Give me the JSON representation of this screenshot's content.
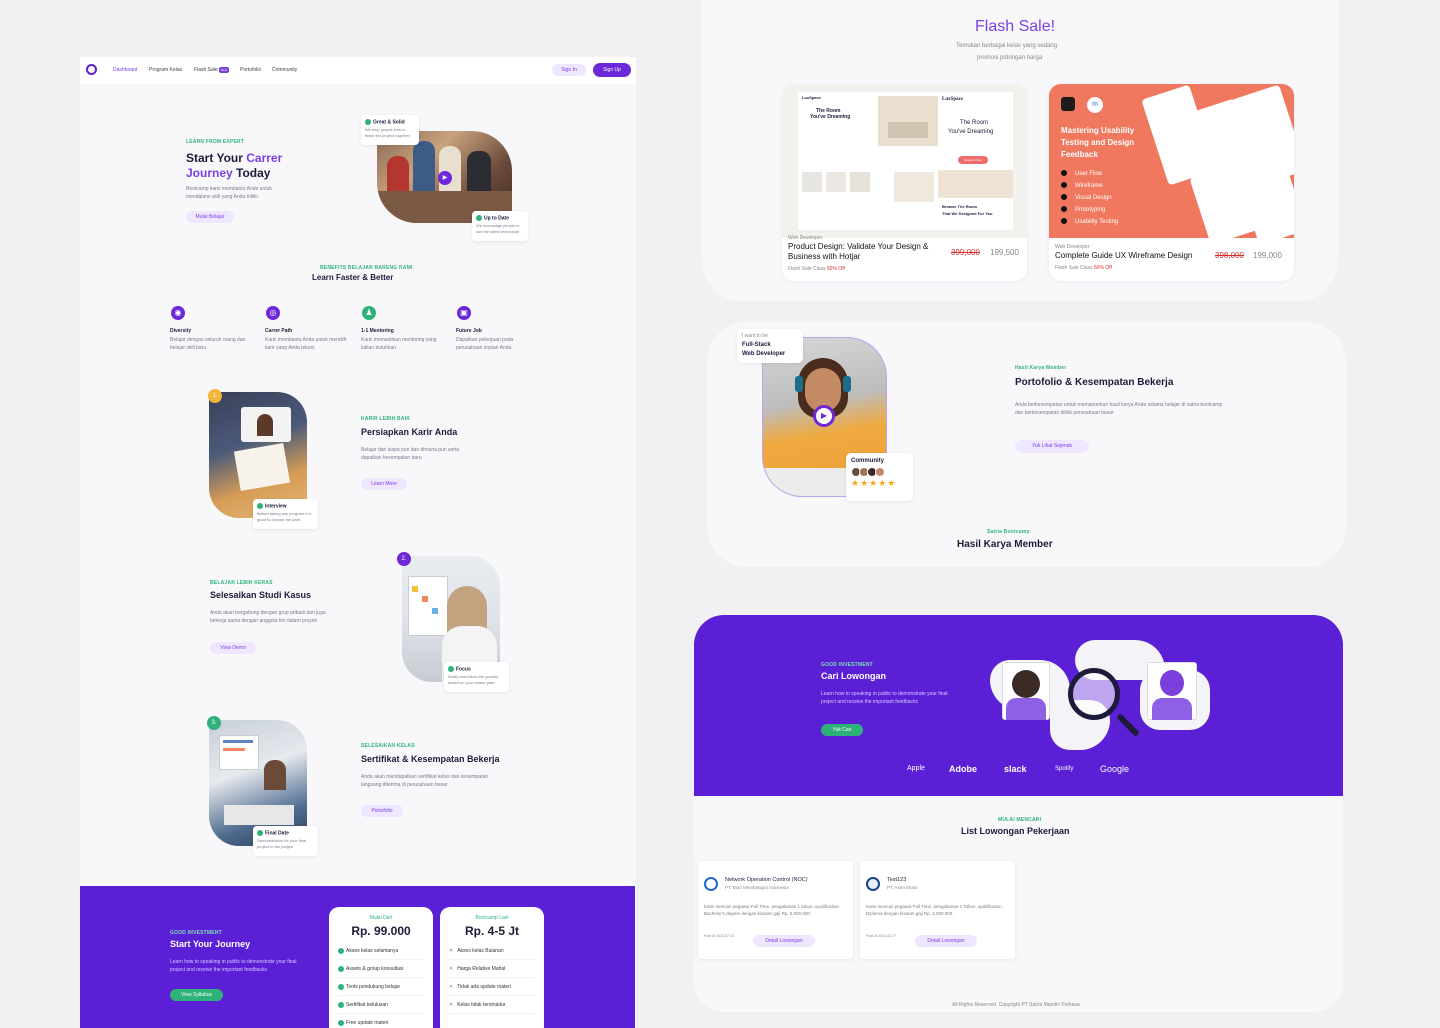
{
  "nav": {
    "items": [
      "Dashboard",
      "Program Kelas",
      "Flash Sale",
      "Portofolio",
      "Community"
    ],
    "flash_badge": "New",
    "signin": "Sign In",
    "signup": "Sign Up"
  },
  "hero": {
    "label": "LEARN FROM EXPERT",
    "title_line1_a": "Start Your ",
    "title_line1_b": "Carrer",
    "title_line2_a": "Journey",
    "title_line2_b": " Today",
    "desc": "Bootcamp kami membantu Anda untuk mendalami skill yang Anda miliki",
    "cta": "Mulai Belajar",
    "badge1_title": "Great & Solid",
    "badge1_desc": "We help people how to finish the project together",
    "badge2_title": "Up to Date",
    "badge2_desc": "We encourage people to use the latest technolodi"
  },
  "benefits": {
    "label": "BENEFITS BELAJAR BARENG KAMI",
    "title": "Learn Faster & Better",
    "items": [
      {
        "title": "Diversity",
        "desc": "Belajar dengan seluruh orang dan belajar skill baru"
      },
      {
        "title": "Carrer Path",
        "desc": "Kami membantu Anda untuk memilih karir yang Anda tekuni"
      },
      {
        "title": "1-1 Mentoring",
        "desc": "Kami memastikan mentoring yang kalian butuhkan"
      },
      {
        "title": "Future Job",
        "desc": "Dapatkan pekerjaan pada perusahaan impian Anda"
      }
    ]
  },
  "steps": [
    {
      "num": "1.",
      "label": "KARIR LEBIH BAIK",
      "title": "Persiapkan Karir Anda",
      "desc": "Belajar dari siapa pun dan dimana pun serta dapatkan kesempatan baru",
      "cta": "Learn More",
      "badge_title": "Interview",
      "badge_desc": "Before taking any program it is good to choose the path"
    },
    {
      "num": "2.",
      "label": "BELAJAR LEBIH KERAS",
      "title": "Selesaikan Studi Kasus",
      "desc": "Anda akan bergabung dengan grup pribadi dan juga bekerja sama dengan anggota tim dalam proyek",
      "cta": "View Demo",
      "badge_title": "Focus",
      "badge_desc": "Study and follow the journey based on your career path"
    },
    {
      "num": "3.",
      "label": "SELESAIKAN KELAS",
      "title": "Sertifikat & Kesempatan Bekerja",
      "desc": "Anda akan mendapatkan sertifikat kelas dan kesempatan langsung diterima di perusahaan besar",
      "cta": "Portofolio",
      "badge_title": "Final Date",
      "badge_desc": "Demonstration for your final project to the judges"
    }
  ],
  "journey": {
    "label": "GOOD INVESTMENT",
    "title": "Start Your Journey",
    "desc": "Learn how to speaking in public to demonstrate your final project and receive the important feedbacks",
    "cta": "View Syllabus",
    "plan1": {
      "label": "Mulai Dari",
      "price": "Rp. 99.000",
      "items": [
        "Akses kelas selamanya",
        "Assets & group konsultasi",
        "Tools pendukung belajar",
        "Sertifikat kelulusan",
        "Free update materi"
      ]
    },
    "plan2": {
      "label": "Bootcamp Lain",
      "price": "Rp. 4-5 Jt",
      "items": [
        "Akses kelas Bulanan",
        "Harga Relative Mahal",
        "Tidak ada update materi",
        "Kelas tidak terstruktur"
      ]
    }
  },
  "flash": {
    "title": "Flash Sale!",
    "desc1": "Temukan berbagai kelas yang sedang",
    "desc2": "promosi potongan harga",
    "card1": {
      "category": "Web Developer",
      "title1": "Product Design: Validate Your Design &",
      "title2": "Business with Hotjar",
      "old_price": "399,000",
      "price": "199,500",
      "sub": "Flash Sale Class ",
      "discount": "50% Off",
      "brand": "LuxSpace",
      "hero_text1": "The Room",
      "hero_text2": "You've Dreaming",
      "explore": "Explore Now",
      "bottom1": "Browse The Room",
      "bottom2": "That We Designed For You"
    },
    "card2": {
      "category": "Web Developer",
      "title": "Complete Guide UX Wireframe Design",
      "old_price": "398,000",
      "price": "199,000",
      "sub": "Flash Sale Class ",
      "discount": "50% Off",
      "heading1": "Mastering Usability",
      "heading2": "Testing and Design",
      "heading3": "Feedback",
      "list": [
        "User Flow",
        "Wireframe",
        "Visual Design",
        "Prototyping",
        "Usability Testing"
      ]
    }
  },
  "portfolio": {
    "badge_small": "I want to be",
    "badge_line1": "Full-Stack",
    "badge_line2": "Web Developer",
    "community": "Community",
    "stars": "★★★★★",
    "label": "Hasil Karya Member",
    "title": "Portofolio & Kesempatan Bekerja",
    "desc": "Anda berkesempatan untuk memamerkan hasil karya Anda selama belajar di satria bootcamp dan berkesempatan dilirik perusahaan besar",
    "cta": "Yuk Lihat Sejenak",
    "footer_label": "Satria Bootcamp",
    "footer_title": "Hasil Karya Member"
  },
  "jobs": {
    "label": "GOOD INVESTMENT",
    "title": "Cari Lowongan",
    "desc": "Learn how to speaking in public to demonstrate your final project and receive the important feedbacks",
    "cta": "Yuk Cari",
    "logos": [
      "Apple",
      "Adobe",
      "slack",
      "Spotify",
      "Google"
    ],
    "list_label": "MULAI MENCARI",
    "list_title": "List Lowongan Pekerjaan",
    "cards": [
      {
        "title": "Network Operation Control (NOC)",
        "company": "PT. Bion Membangun Indonesia",
        "desc": "Kami mencari pegawai Full Time, pengalaman 1 tahun, qualification Bachelor's degree dengan kisaran gaji Rp. 5,000,000.",
        "date": "Post At 2022-07-03",
        "cta": "Detail Lowongan"
      },
      {
        "title": "Test123",
        "company": "PT. Astra Motor",
        "desc": "Kami mencari pegawai Full Time, pengalaman 2 Tahun, qualification Diploma dengan kisaran gaji Rp. 2,000,000.",
        "date": "Post At 2022-02-27",
        "cta": "Detail Lowongan"
      }
    ],
    "copyright": "All Rights Reserved. Copyright PT Satria Mandiri Perkasa"
  },
  "colors": {
    "purple": "#5b1fd6",
    "accent": "#7b3fe4",
    "green": "#2fb27a",
    "salmon": "#f0785f"
  }
}
